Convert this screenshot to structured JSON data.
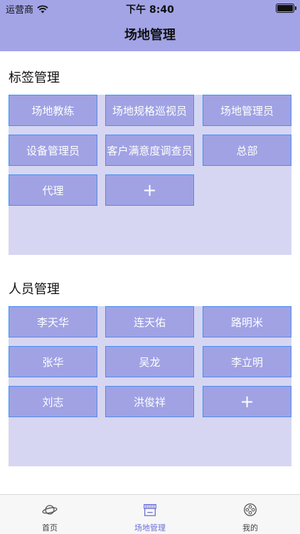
{
  "status_bar": {
    "carrier": "运营商",
    "time": "下午 8:40"
  },
  "nav": {
    "title": "场地管理"
  },
  "tags_section": {
    "title": "标签管理",
    "chips": [
      "场地教练",
      "场地规格巡视员",
      "场地管理员",
      "设备管理员",
      "客户满意度调查员",
      "总部",
      "代理"
    ],
    "add_label": "+"
  },
  "people_section": {
    "title": "人员管理",
    "chips": [
      "李天华",
      "连天佑",
      "路明米",
      "张华",
      "吴龙",
      "李立明",
      "刘志",
      "洪俊祥"
    ],
    "add_label": "+"
  },
  "tab_bar": {
    "tabs": [
      {
        "label": "首页",
        "icon": "planet-icon"
      },
      {
        "label": "场地管理",
        "icon": "stall-icon"
      },
      {
        "label": "我的",
        "icon": "film-reel-icon"
      }
    ],
    "active_index": 1
  },
  "colors": {
    "header": "#a3a4e6",
    "chip_fill": "#a0a2e4",
    "chip_border": "#4a8ef0",
    "panel": "#d6d6f2",
    "tab_active": "#6d6fd6"
  }
}
